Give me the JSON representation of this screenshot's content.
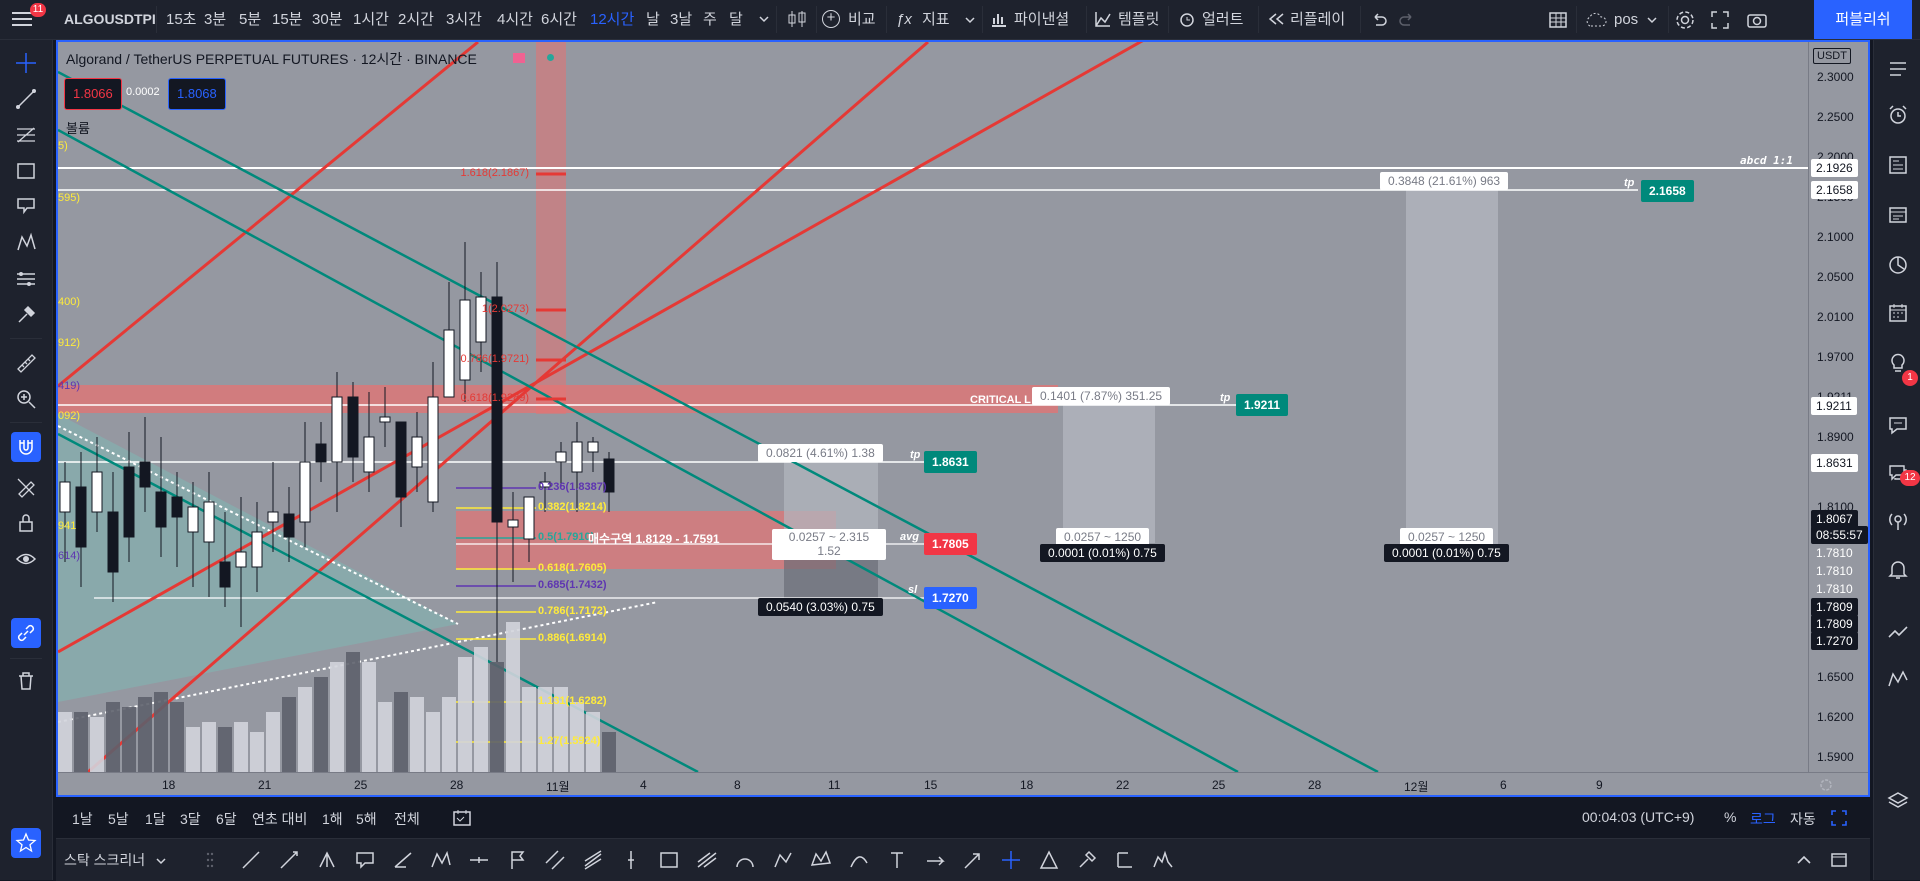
{
  "topbar": {
    "badge_count": "11",
    "symbol": "ALGOUSDTPI",
    "intervals": [
      "15초",
      "3분",
      "5분",
      "15분",
      "30분",
      "1시간",
      "2시간",
      "3시간",
      "4시간",
      "6시간",
      "12시간",
      "날",
      "3날",
      "주",
      "달"
    ],
    "selected_interval": "12시간",
    "compare_label": "비교",
    "indicators_label": "지표",
    "financials_label": "파이낸셜",
    "templates_label": "템플릿",
    "alerts_label": "얼러트",
    "replay_label": "리플레이",
    "layout_name": "pos",
    "publish_label": "퍼블리쉬"
  },
  "legend": {
    "title": "Algorand / TetherUS PERPETUAL FUTURES · 12시간 · BINANCE",
    "sell_price": "1.8066",
    "spread": "0.0002",
    "buy_price": "1.8068",
    "volume_label": "볼륨"
  },
  "left_fib_labels": [
    "5)",
    "595)",
    "400)",
    "912)",
    "419)",
    "092)",
    "941",
    "614)"
  ],
  "fib_extension": [
    {
      "label": "1.618(2.1867)",
      "color": "#e53935"
    },
    {
      "label": "1(2.0273)",
      "color": "#e53935"
    },
    {
      "label": "0.786(1.9721)",
      "color": "#e53935"
    },
    {
      "label": "0.618(1.9289)",
      "color": "#e53935"
    }
  ],
  "fib_retracement": [
    {
      "label": "0.236(1.8387)",
      "color": "#5e35b1"
    },
    {
      "label": "0.382(1.8214)",
      "color": "#ffeb3b"
    },
    {
      "label": "0.5(1.7910)",
      "color": "#26a69a"
    },
    {
      "label": "0.618(1.7605)",
      "color": "#ffeb3b"
    },
    {
      "label": "0.685(1.7432)",
      "color": "#5e35b1"
    },
    {
      "label": "0.786(1.7172)",
      "color": "#ffeb3b"
    },
    {
      "label": "0.886(1.6914)",
      "color": "#ffeb3b"
    },
    {
      "label": "1.131(1.6282)",
      "color": "#ffeb3b"
    },
    {
      "label": "1.27(1.5924)",
      "color": "#ffeb3b"
    }
  ],
  "annotations": {
    "critical": "CRITICAL L",
    "zone": "매수구역 1.8129 - 1.7591",
    "abcd": "abcd 1:1",
    "tp": "tp",
    "avg": "avg",
    "sl": "sl"
  },
  "badges": {
    "tp_top": "2.1658",
    "tp_mid": "1.9211",
    "tp_low": "1.8631",
    "avg": "1.7805",
    "sl": "1.7270"
  },
  "stat_boxes": {
    "top_range": "0.3848 (21.61%) 963",
    "mid_range": "0.1401 (7.87%) 351.25",
    "low_range": "0.0821 (4.61%) 1.38",
    "avg_range_1": "0.0257 ~ 2.315",
    "avg_range_2": "1.52",
    "sl_range": "0.0540 (3.03%) 0.75",
    "mid_avg": "0.0257 ~ 1250",
    "mid_min": "0.0001 (0.01%) 0.75",
    "right_avg": "0.0257 ~ 1250",
    "right_min": "0.0001 (0.01%) 0.75"
  },
  "price_axis": {
    "currency": "USDT",
    "labels": [
      "2.3000",
      "2.2500",
      "2.2000",
      "2.1500",
      "2.1000",
      "2.0500",
      "2.0100",
      "1.9700",
      "1.9211",
      "1.8900",
      "1.8500",
      "1.8100",
      "1.7700",
      "1.7300",
      "1.6800",
      "1.6500",
      "1.6200",
      "1.5900"
    ],
    "tags": [
      {
        "text": "2.1926",
        "bg": "#ffffff",
        "fg": "#131722"
      },
      {
        "text": "2.1658",
        "bg": "#ffffff",
        "fg": "#131722"
      },
      {
        "text": "1.9211",
        "bg": "#ffffff",
        "fg": "#131722"
      },
      {
        "text": "1.8631",
        "bg": "#ffffff",
        "fg": "#131722"
      },
      {
        "text": "1.8067",
        "bg": "#131722",
        "fg": "#ffffff"
      },
      {
        "text": "08:55:57",
        "bg": "#131722",
        "fg": "#ffffff"
      },
      {
        "text": "1.7810",
        "bg": "#9598a1",
        "fg": "#ffffff"
      },
      {
        "text": "1.7810",
        "bg": "#9598a1",
        "fg": "#ffffff"
      },
      {
        "text": "1.7810",
        "bg": "#9598a1",
        "fg": "#ffffff"
      },
      {
        "text": "1.7809",
        "bg": "#131722",
        "fg": "#ffffff"
      },
      {
        "text": "1.7809",
        "bg": "#131722",
        "fg": "#ffffff"
      },
      {
        "text": "1.7270",
        "bg": "#131722",
        "fg": "#ffffff"
      }
    ]
  },
  "time_axis": [
    "18",
    "21",
    "25",
    "28",
    "11월",
    "4",
    "8",
    "11",
    "15",
    "18",
    "22",
    "25",
    "28",
    "12월",
    "6",
    "9"
  ],
  "bottom": {
    "ranges": [
      "1날",
      "5날",
      "1달",
      "3달",
      "6달",
      "연초 대비",
      "1해",
      "5해",
      "전체"
    ],
    "clock": "00:04:03 (UTC+9)",
    "percent": "%",
    "log": "로그",
    "auto": "자동"
  },
  "drawbar": {
    "screener_label": "스탁 스크리너"
  },
  "rightbar_badges": {
    "chat": "1",
    "notifications": "12"
  },
  "colors": {
    "accent": "#2962ff",
    "red": "#e53935",
    "teal": "#00897b",
    "chart_bg": "#9598a1"
  }
}
